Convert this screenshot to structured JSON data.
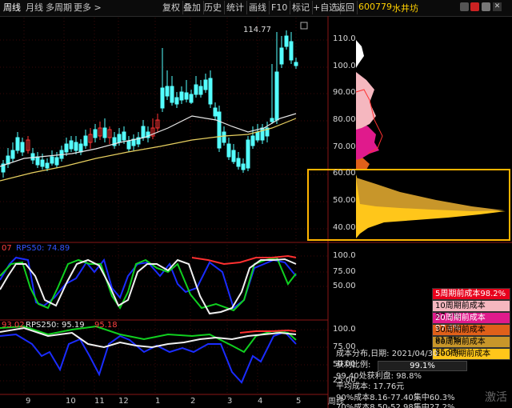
{
  "topbar": {
    "tabs": [
      "周线",
      "月线",
      "多周期",
      "更多 >"
    ],
    "buttons": [
      "复权",
      "叠加",
      "历史",
      "统计",
      "画线",
      "F10",
      "标记",
      "+自选",
      "返回"
    ],
    "stock_code": "600779",
    "stock_name": "水井坊"
  },
  "price_axis": [
    "110.0",
    "100.0",
    "90.00",
    "80.00",
    "70.00",
    "60.00",
    "50.00",
    "40.00"
  ],
  "peak_label": "114.77",
  "ind1": {
    "labels": [
      "07",
      "RPS50: 74.89"
    ],
    "axis": [
      "100.0",
      "75.00",
      "50.00"
    ]
  },
  "ind2": {
    "labels": [
      "93.02",
      "RPS250: 95.19",
      "95.18"
    ],
    "axis": [
      "100.0",
      "75.00",
      "50.00",
      "25.00"
    ]
  },
  "x_ticks": [
    "9",
    "10",
    "11",
    "12",
    "1",
    "2",
    "3",
    "4",
    "5"
  ],
  "period_tab": "周线",
  "legend": [
    {
      "label": "5周期前成本98.2%",
      "bg": "#e8001c",
      "fg": "#ffffff"
    },
    {
      "label": "10周期前成本97.2%",
      "bg": "#f5b7bf",
      "fg": "#000000"
    },
    {
      "label": "20周期前成本97.6%",
      "bg": "#e01a8c",
      "fg": "#ffffff"
    },
    {
      "label": "30周期前成本91.7%",
      "bg": "#e0601a",
      "fg": "#000000"
    },
    {
      "label": "60周期前成本85.9%",
      "bg": "#c8962a",
      "fg": "#000000"
    },
    {
      "label": "100周期前成本80.0%",
      "bg": "#ffc61a",
      "fg": "#000000"
    }
  ],
  "stats": {
    "line1": "成本分布,日期: 2021/04/30",
    "line2_label": "获利比例:",
    "line2_value": "99.1%",
    "line3": "99.40处获利盘: 98.8%",
    "line4": "平均成本: 17.76元",
    "line5": "90%成本8.16-77.40集中60.3%",
    "line6": "70%成本8.50-52.98集中27.2%"
  },
  "watermark": "激活",
  "colors": {
    "up": "#ff3232",
    "down": "#54ffff",
    "ma1": "#e8e8e8",
    "ma2": "#e8d060",
    "frame": "#8a1616",
    "highlight": "#ffb400"
  }
}
